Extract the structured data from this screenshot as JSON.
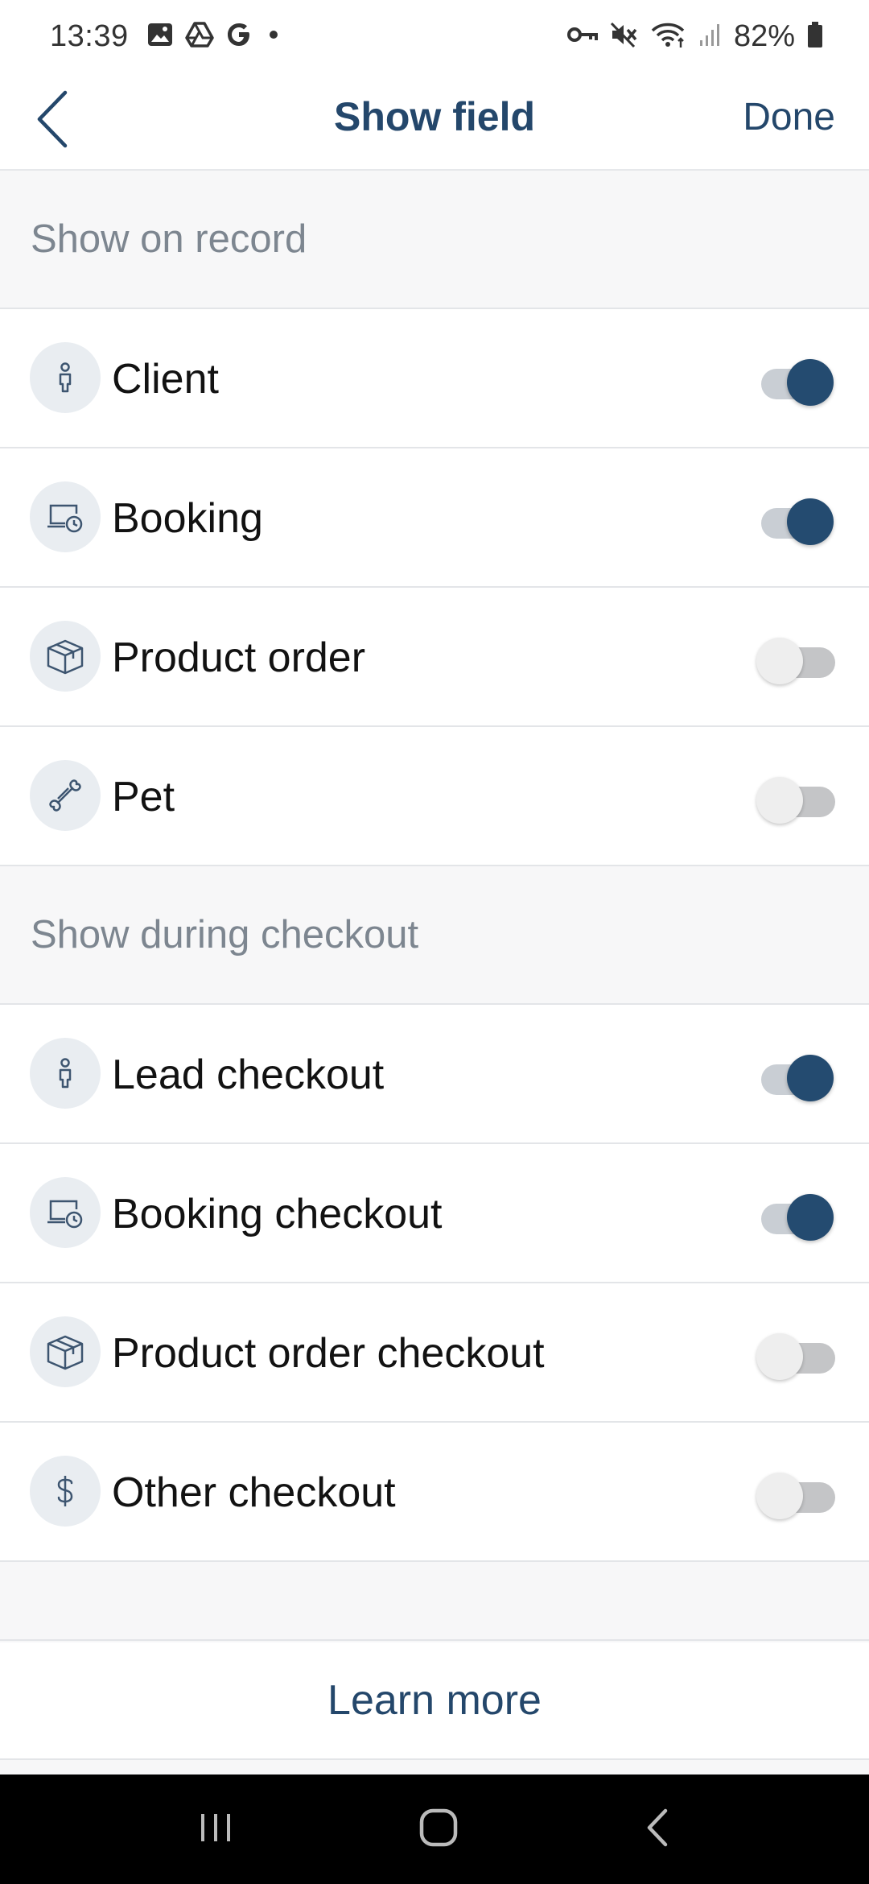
{
  "status_bar": {
    "time": "13:39",
    "battery": "82%",
    "left_icons": [
      "image-icon",
      "drive-icon",
      "google-icon",
      "dot-icon"
    ],
    "right_icons": [
      "vpn-key-icon",
      "mute-icon",
      "wifi-icon",
      "signal-icon",
      "battery-icon"
    ]
  },
  "header": {
    "title": "Show field",
    "done_label": "Done",
    "back_icon": "chevron-left-icon"
  },
  "sections": [
    {
      "title": "Show on record",
      "items": [
        {
          "label": "Client",
          "icon": "person-icon",
          "enabled": true
        },
        {
          "label": "Booking",
          "icon": "booking-clock-icon",
          "enabled": true
        },
        {
          "label": "Product order",
          "icon": "box-icon",
          "enabled": false
        },
        {
          "label": "Pet",
          "icon": "bone-icon",
          "enabled": false
        }
      ]
    },
    {
      "title": "Show during checkout",
      "items": [
        {
          "label": "Lead checkout",
          "icon": "person-icon",
          "enabled": true
        },
        {
          "label": "Booking checkout",
          "icon": "booking-clock-icon",
          "enabled": true
        },
        {
          "label": "Product order checkout",
          "icon": "box-icon",
          "enabled": false
        },
        {
          "label": "Other checkout",
          "icon": "dollar-icon",
          "enabled": false
        }
      ]
    }
  ],
  "footer": {
    "learn_more_label": "Learn more"
  },
  "system_nav": [
    "recents-icon",
    "home-icon",
    "back-icon"
  ],
  "colors": {
    "accent": "#24476b",
    "toggle_on": "#244b70",
    "section_text": "#7d8690",
    "icon_bg": "#e9edf1"
  }
}
